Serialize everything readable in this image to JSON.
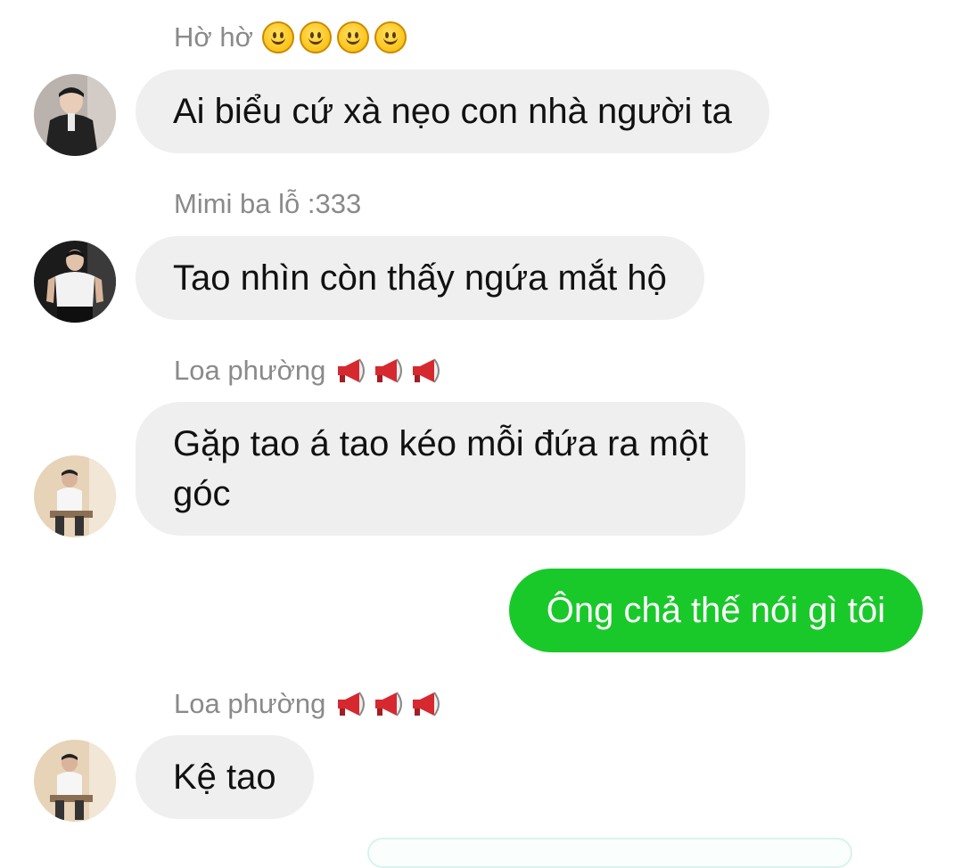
{
  "messages": [
    {
      "sender": "Hờ hờ",
      "sender_emoji": [
        "smiley-face",
        "smiley-face",
        "smiley-face",
        "smiley-face"
      ],
      "text": "Ai biểu cứ xà nẹo con nhà người ta",
      "avatar": "avatar-man-dark-jacket"
    },
    {
      "sender": "Mimi ba lỗ :333",
      "text": "Tao nhìn còn thấy ngứa mắt hộ",
      "avatar": "avatar-man-white-tank"
    },
    {
      "sender": "Loa phường",
      "sender_emoji": [
        "megaphone",
        "megaphone",
        "megaphone"
      ],
      "text_line1": "Gặp tao á tao kéo mỗi đứa ra một",
      "text_line2": "góc",
      "avatar": "avatar-man-sitting"
    },
    {
      "own": true,
      "text": "Ông chả thế nói gì tôi",
      "color": "#19c92a"
    },
    {
      "sender": "Loa phường",
      "sender_emoji": [
        "megaphone",
        "megaphone",
        "megaphone"
      ],
      "text": "Kệ tao",
      "avatar": "avatar-man-sitting"
    }
  ],
  "colors": {
    "incoming_bubble": "#efefef",
    "outgoing_bubble": "#19c92a",
    "sender_name": "#8a8a8a"
  }
}
